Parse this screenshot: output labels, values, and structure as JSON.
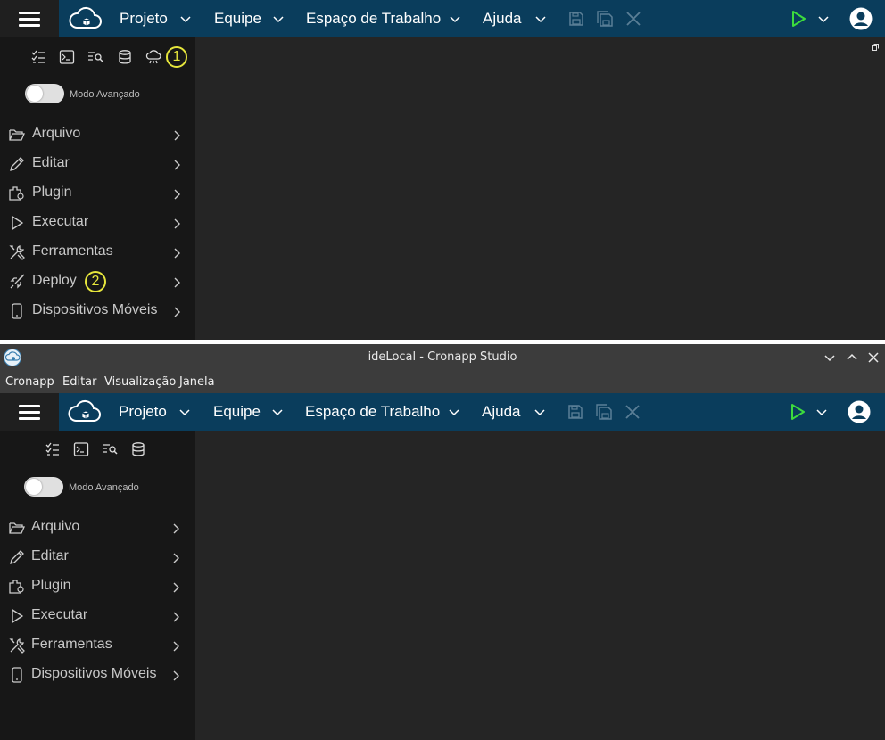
{
  "top": {
    "menu": [
      "Projeto",
      "Equipe",
      "Espaço de Trabalho",
      "Ajuda"
    ],
    "toggle_label": "Modo Avançado",
    "nav": [
      "Arquivo",
      "Editar",
      "Plugin",
      "Executar",
      "Ferramentas",
      "Deploy",
      "Dispositivos Móveis"
    ],
    "badges": [
      "1",
      "2"
    ]
  },
  "bottom": {
    "window_title": "ideLocal - Cronapp Studio",
    "menubar": [
      "Cronapp",
      "Editar",
      "Visualização",
      "Janela"
    ],
    "menu": [
      "Projeto",
      "Equipe",
      "Espaço de Trabalho",
      "Ajuda"
    ],
    "toggle_label": "Modo Avançado",
    "nav": [
      "Arquivo",
      "Editar",
      "Plugin",
      "Executar",
      "Ferramentas",
      "Dispositivos Móveis"
    ]
  },
  "colors": {
    "topbar": "#0a3d5c",
    "sidebar": "#171717",
    "content": "#252525",
    "play": "#3ddc3d",
    "badge": "#e6e63c"
  },
  "icons": {
    "toolbar": [
      "save-icon",
      "save-all-icon",
      "close-icon"
    ],
    "sidebar_tools": [
      "checklist-icon",
      "terminal-icon",
      "search-list-icon",
      "database-icon",
      "cloud-bug-icon"
    ],
    "nav": [
      "folder-open-icon",
      "pencil-icon",
      "plugin-icon",
      "play-outline-icon",
      "tools-icon",
      "rocket-icon",
      "mobile-icon"
    ]
  }
}
